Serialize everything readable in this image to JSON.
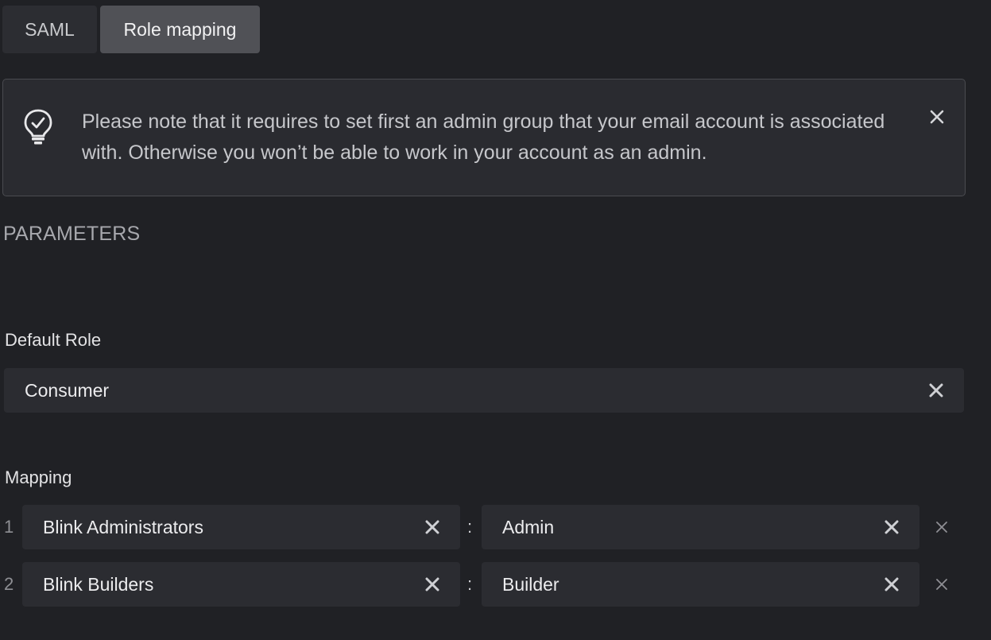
{
  "tabs": [
    {
      "label": "SAML",
      "active": false
    },
    {
      "label": "Role mapping",
      "active": true
    }
  ],
  "notice": {
    "icon": "lightbulb-check-icon",
    "text": "Please note that it requires to set first an admin group that your email account is associated with. Otherwise you won’t be able to work in your account as an admin.",
    "close_icon": "close-icon"
  },
  "parameters": {
    "title": "PARAMETERS",
    "default_role": {
      "label": "Default Role",
      "value": "Consumer"
    },
    "mapping": {
      "label": "Mapping",
      "separator": ":",
      "rows": [
        {
          "index": "1",
          "group": "Blink Administrators",
          "role": "Admin"
        },
        {
          "index": "2",
          "group": "Blink Builders",
          "role": "Builder"
        }
      ]
    }
  },
  "colors": {
    "background": "#202125",
    "field_bg": "#2b2c31",
    "active_tab": "#505156",
    "inactive_tab": "#2c2d32"
  }
}
